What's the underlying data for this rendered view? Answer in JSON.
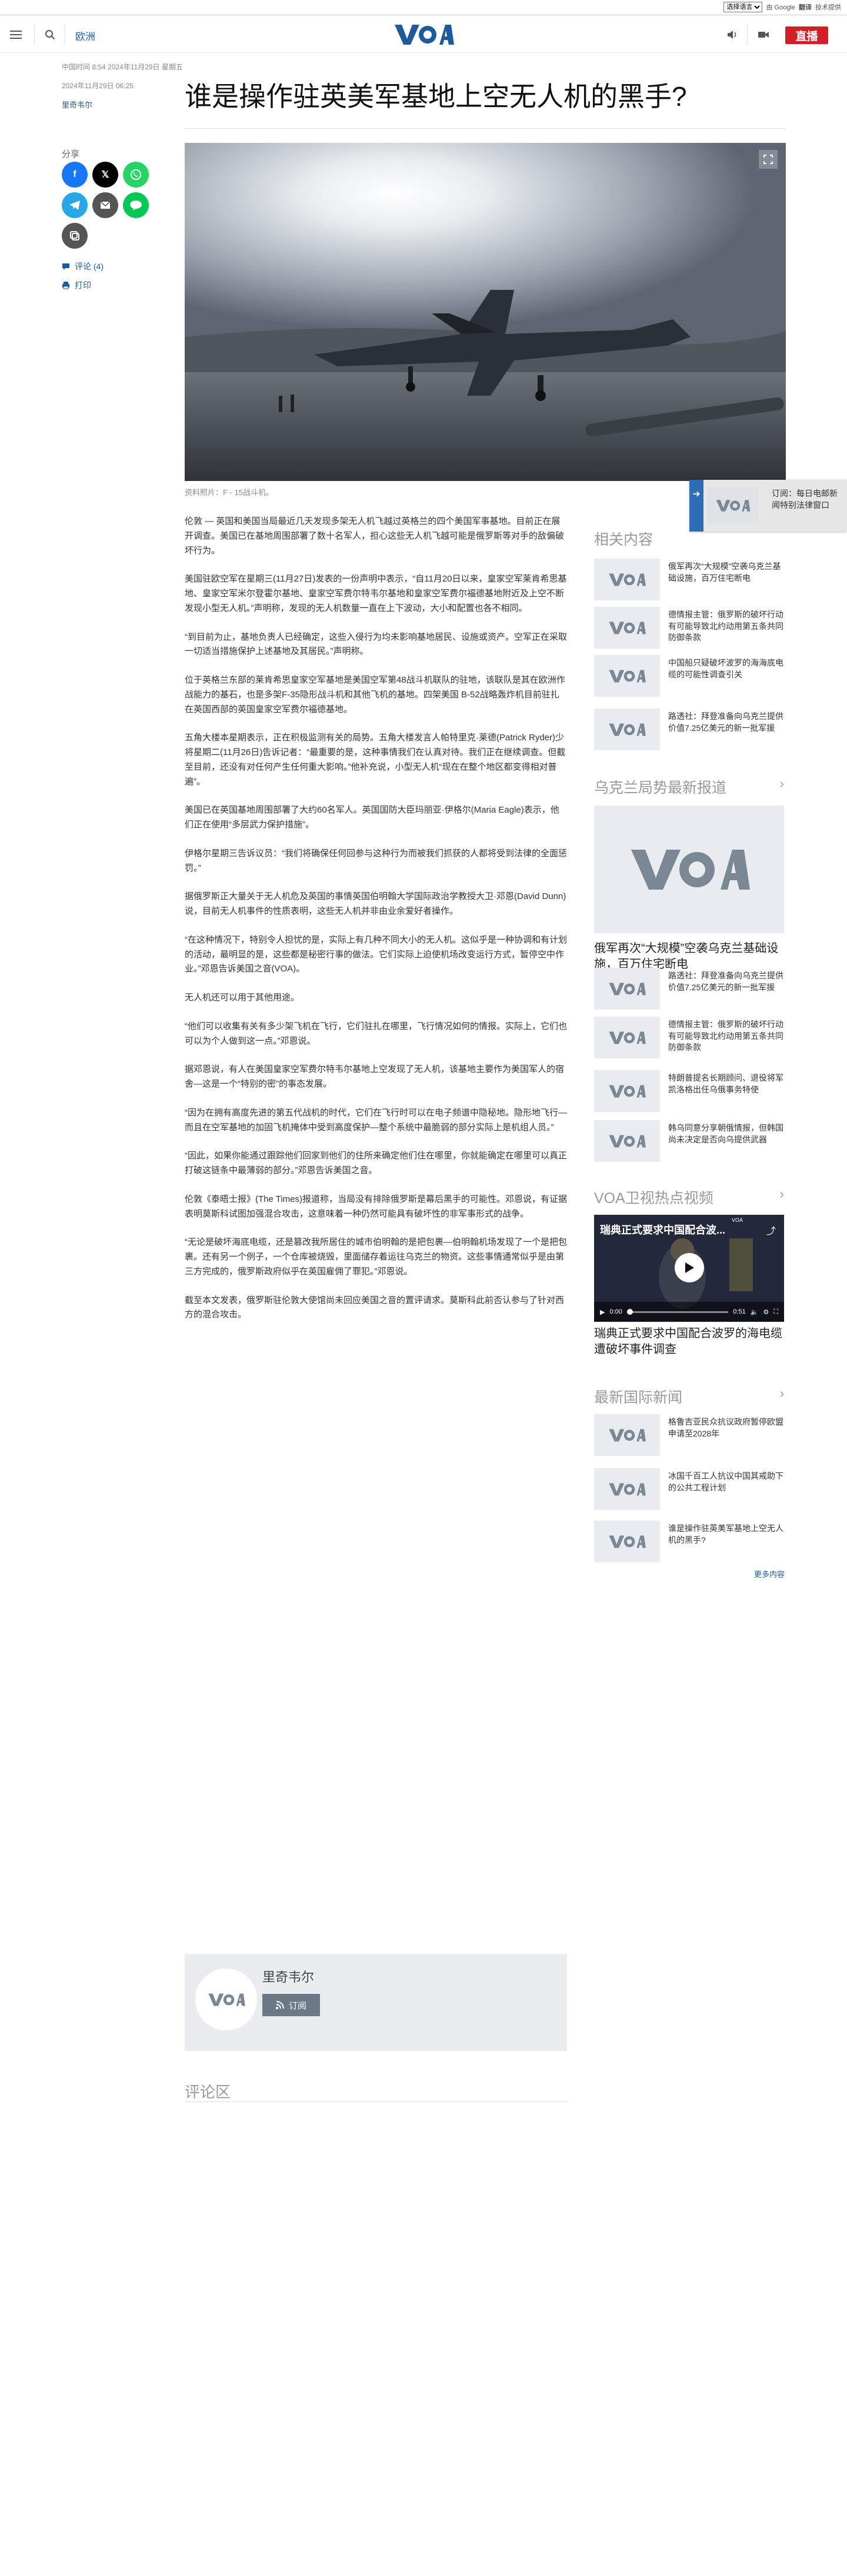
{
  "translate_bar": {
    "select_label": "选择语言",
    "by": "由 Google",
    "brand": "翻译",
    "powered": "技术提供"
  },
  "header": {
    "section": "欧洲",
    "live": "直播"
  },
  "article": {
    "published": "2024年11月29日 06:25",
    "time_line": "中国时间 8:54 2024年11月29日 星期五",
    "author": "里奇韦尔",
    "title": "谁是操作驻英美军基地上空无人机的黑手?",
    "caption": "资料照片：F - 15战斗机。",
    "paragraphs": [
      "伦敦 — 英国和美国当局最近几天发现多架无人机飞越过英格兰的四个美国军事基地。目前正在展开调查。美国已在基地周围部署了数十名军人，担心这些无人机飞越可能是俄罗斯等对手的敌偏破坏行为。",
      "美国驻欧空军在星期三(11月27日)发表的一份声明中表示，“自11月20日以来，皇家空军莱肯希思基地、皇家空军米尔登霍尔基地、皇家空军费尔特韦尔基地和皇家空军费尔福德基地附近及上空不断发现小型无人机。”声明称，发现的无人机数量一直在上下波动，大小和配置也各不相同。",
      "“到目前为止，基地负责人已经确定，这些入侵行为均未影响基地居民、设施或资产。空军正在采取一切适当措施保护上述基地及其居民。”声明称。",
      "位于英格兰东部的莱肯希思皇家空军基地是美国空军第48战斗机联队的驻地，该联队是其在欧洲作战能力的基石，也是多架F-35隐形战斗机和其他飞机的基地。四架美国 B-52战略轰炸机目前驻扎在英国西部的英国皇家空军费尔福德基地。",
      "五角大楼本星期表示，正在积极监测有关的局势。五角大楼发言人帕特里克·莱德(Patrick Ryder)少将星期二(11月26日)告诉记者：“最重要的是，这种事情我们在认真对待。我们正在继续调查。但截至目前，还没有对任何产生任何重大影响。”他补充说，小型无人机“现在在整个地区都变得相对普遍”。",
      "美国已在英国基地周围部署了大约60名军人。英国国防大臣玛丽亚·伊格尔(Maria Eagle)表示，他们正在使用“多层武力保护措施”。",
      "伊格尔星期三告诉议员：“我们将确保任何回参与这种行为而被我们抓获的人都将受到法律的全面惩罚。”",
      "据俄罗斯正大量关于无人机危及英国的事情英国伯明翰大学国际政治学教授大卫·邓恩(David Dunn)说，目前无人机事件的性质表明，这些无人机并非由业余爱好者操作。",
      "“在这种情况下，特别令人担忧的是，实际上有几种不同大小的无人机。这似乎是一种协调和有计划的活动，最明显的是，这些都是秘密行事的做法。它们实际上迫使机场改变运行方式，暂停空中作业。”邓恩告诉美国之音(VOA)。",
      "无人机还可以用于其他用途。",
      "“他们可以收集有关有多少架飞机在飞行，它们驻扎在哪里，飞行情况如何的情报。实际上，它们也可以为个人做到这一点。”邓恩说。",
      "据邓恩说，有人在美国皇家空军费尔特韦尔基地上空发现了无人机，该基地主要作为美国军人的宿舍—这是一个“特别的密”的事态发展。",
      "“因为在拥有高度先进的第五代战机的时代，它们在飞行时可以在电子频谱中隐秘地。隐形地飞行—而且在空军基地的加固飞机掩体中受到高度保护—整个系统中最脆弱的部分实际上是机组人员。”",
      "“因此，如果你能通过跟踪他们回家到他们的住所来确定他们住在哪里，你就能确定在哪里可以真正打破这链条中最薄弱的部分。”邓恩告诉美国之音。",
      "伦敦《泰晤士报》(The Times)报道称，当局没有排除俄罗斯是幕后黑手的可能性。邓恩说，有证据表明莫斯科试图加强混合攻击，这意味着一种仍然可能具有破坏性的非军事形式的战争。",
      "“无论是破坏海底电缆，还是篡改我所居住的城市伯明翰的是把包裹—伯明翰机场发现了一个是把包裹。还有另一个例子，一个仓库被烧毁，里面储存着运往乌克兰的物资。这些事情通常似乎是由第三方完成的，俄罗斯政府似乎在英国雇佣了罪犯。”邓恩说。",
      "截至本文发表，俄罗斯驻伦敦大使馆尚未回应美国之音的置评请求。莫斯科此前否认参与了针对西方的混合攻击。"
    ],
    "subscribe": "订阅",
    "comments_heading": "评论区"
  },
  "share": {
    "label": "分享",
    "comments": "评论 (4)",
    "print": "打印"
  },
  "popup": {
    "text": "订阅：每日电邮新闻特别法律窗口"
  },
  "sidebar": {
    "related": {
      "heading": "相关内容",
      "items": [
        "俄军再次“大规模”空袭乌克兰基础设施，百万住宅断电",
        "德情报主管：俄罗斯的破坏行动有可能导致北约动用第五条共同防御条款",
        "中国船只疑破坏波罗的海海底电缆的可能性调查引关",
        "路透社：拜登准备向乌克兰提供价值7.25亿美元的新一批军援"
      ]
    },
    "ukraine": {
      "heading": "乌克兰局势最新报道",
      "lead": "俄军再次“大规模”空袭乌克兰基础设施，百万住宅断电",
      "items": [
        "路透社：拜登准备向乌克兰提供价值7.25亿美元的新一批军援",
        "德情报主管：俄罗斯的破坏行动有可能导致北约动用第五条共同防御条款",
        "特朗普提名长期顾问、退役将军凯洛格出任乌俄事务特使",
        "韩乌同意分享朝俄情报，但韩国尚未决定是否向乌提供武器"
      ]
    },
    "video": {
      "heading": "VOA卫视热点视频",
      "overlay_title": "瑞典正式要求中国配合波...",
      "badge": "VOA",
      "time_current": "0:00",
      "time_total": "0:51",
      "title": "瑞典正式要求中国配合波罗的海电缆遭破坏事件调查"
    },
    "intl": {
      "heading": "最新国际新闻",
      "items": [
        "格鲁吉亚民众抗议政府暂停欧盟申请至2028年",
        "冰国千百工人抗议中国其戒助下的公共工程计划",
        "谁是操作驻英美军基地上空无人机的黑手?"
      ],
      "more": "更多内容"
    }
  },
  "colors": {
    "brand_blue": "#1d5a9e",
    "live_red": "#d11f26"
  }
}
